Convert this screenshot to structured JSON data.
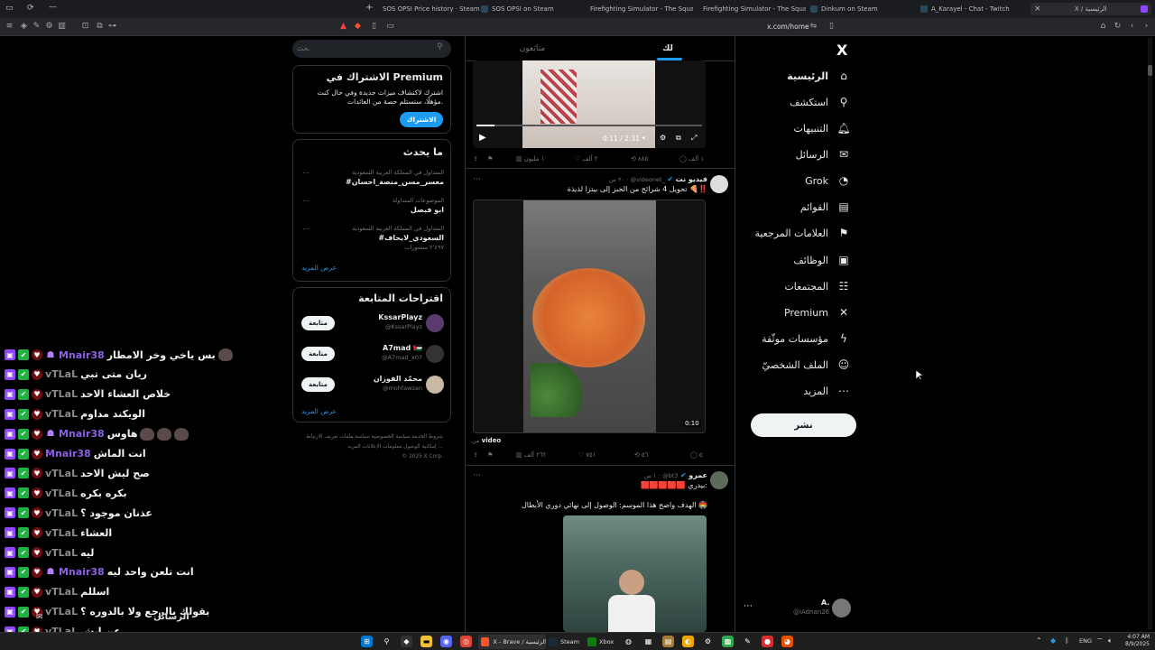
{
  "browser": {
    "tabs": [
      {
        "label": "SOS OPSI Price history · SteamDB",
        "color": "#8e0d0d"
      },
      {
        "label": "SOS OPSI on Steam",
        "color": "#171a21"
      },
      {
        "label": "Firefighting Simulator - The Squad",
        "color": "#c33"
      },
      {
        "label": "Firefighting Simulator - The Squad on",
        "color": "#171a21"
      },
      {
        "label": "Dinkum on Steam",
        "color": "#171a21"
      },
      {
        "label": "A_Karayel - Chat - Twitch",
        "color": "#171a21"
      },
      {
        "label": "X / الرئيسية",
        "color": "#9146ff"
      }
    ],
    "url": "x.com/home",
    "new_tab": "+",
    "close": "×"
  },
  "nav": {
    "logo": "X",
    "items": [
      {
        "label": "الرئيسية",
        "icon": "home-icon",
        "glyph": "⌂",
        "bold": true
      },
      {
        "label": "استكشف",
        "icon": "search-icon",
        "glyph": "⚲"
      },
      {
        "label": "التنبيهات",
        "icon": "bell-icon",
        "glyph": "🔔︎"
      },
      {
        "label": "الرسائل",
        "icon": "mail-icon",
        "glyph": "✉"
      },
      {
        "label": "Grok",
        "icon": "grok-icon",
        "glyph": "◔"
      },
      {
        "label": "القوائم",
        "icon": "list-icon",
        "glyph": "▤"
      },
      {
        "label": "العلامات المرجعية",
        "icon": "bookmark-icon",
        "glyph": "⚑"
      },
      {
        "label": "الوظائف",
        "icon": "briefcase-icon",
        "glyph": "▣"
      },
      {
        "label": "المجتمعات",
        "icon": "people-icon",
        "glyph": "☷"
      },
      {
        "label": "Premium",
        "icon": "x-premium-icon",
        "glyph": "✕"
      },
      {
        "label": "مؤسسات موثّقة",
        "icon": "lightning-icon",
        "glyph": "ϟ"
      },
      {
        "label": "الملف الشخصيّ",
        "icon": "person-icon",
        "glyph": "☺"
      },
      {
        "label": "المزيد",
        "icon": "more-circle-icon",
        "glyph": "⋯"
      }
    ],
    "post_button": "نشر",
    "account": {
      "name": "A.",
      "handle": "@iAdnan26",
      "more": "⋯"
    }
  },
  "feed": {
    "tabs": [
      "لك",
      "متابَعون"
    ],
    "video1": {
      "time": "0:11 / 2:31",
      "actions": {
        "reply": "١ ألف",
        "retweet": "٨٨٥",
        "like": "٢ ألف",
        "views": "١ مليون"
      }
    },
    "tweet2": {
      "name": "فيديو نت",
      "handle": "@videonet_",
      "time": "٢٠ س",
      "text": "تحويل 4 شرائح من الخبز إلى بيتزا لذيذة 🍕‼️",
      "duration": "0:10",
      "from_label": "من",
      "from_source": "video",
      "actions": {
        "reply": "٥",
        "retweet": "٥٦",
        "like": "٧٥١",
        "views": "٢٦٢ ألف"
      }
    },
    "tweet3": {
      "name": "عمرو",
      "handle": "@bt3",
      "time": "١ س",
      "line1": "🟥🟥🟥🟥🟥 بيدري:",
      "line2": "الهدف واضح هذا الموسم: الوصول إلى نهائي دوري الأبطال 🏟️"
    }
  },
  "sidebar": {
    "search_placeholder": "بحث",
    "premium": {
      "title": "الاشتراك في Premium",
      "text1": "اشترك لاكتشاف ميزات جديدة وفي حال كنت",
      "text2": "مؤهلًا، ستستلم حصة من العائدات.",
      "button": "الاشتراك"
    },
    "trends": {
      "title": "ما يحدث",
      "items": [
        {
          "context": "المتداول في المملكة العربية السعودية",
          "tag": "#معسر_مسن_منصة_احسان",
          "count": ""
        },
        {
          "context": "الموضوعات المتداولة",
          "tag": "ابو فيصل",
          "count": ""
        },
        {
          "context": "المتداول في المملكة العربية السعودية",
          "tag": "#السعودي_لايحاف",
          "count": "٢٬٤٩٧ منشورات"
        }
      ],
      "show_more": "عرض المزيد"
    },
    "who_to_follow": {
      "title": "اقتراحات المتابعة",
      "users": [
        {
          "name": "KssarPlayz",
          "handle": "@KssarPlayz",
          "button": "متابعة",
          "color": "#5a3b6e"
        },
        {
          "name": "A7mad 🇯🇴",
          "handle": "@A7mad_x07",
          "button": "متابعة",
          "color": "#333"
        },
        {
          "name": "محمّد الفوزان",
          "handle": "@mohfawzan",
          "button": "متابعة",
          "color": "#c9b8a4"
        }
      ],
      "show_more": "عرض المزيد"
    },
    "footer": {
      "row1": "شروط الخدمة  سياسة الخصوصية  سياسة ملفات تعريف الارتباط",
      "row2": "إمكانية الوصول  معلومات الإعلانات  المزيد ...",
      "row3": "© 2025 X Corp."
    }
  },
  "chat": {
    "messages": [
      {
        "user": "Mnair38",
        "text": "بس ياخي وخر الامطار",
        "emotes": 1,
        "sub": true,
        "purple": true
      },
      {
        "user": "vTLaL",
        "text": "ريان متى تبي",
        "emotes": 0,
        "sub": false,
        "purple": false
      },
      {
        "user": "vTLaL",
        "text": "خلاص العشاء الاحد",
        "emotes": 0,
        "sub": false,
        "purple": false
      },
      {
        "user": "vTLaL",
        "text": "الويكند مداوم",
        "emotes": 0,
        "sub": false,
        "purple": false
      },
      {
        "user": "Mnair38",
        "text": "هاوس",
        "emotes": 3,
        "sub": true,
        "purple": true
      },
      {
        "user": "Mnair38",
        "text": "انت الماش",
        "emotes": 0,
        "sub": false,
        "purple": true
      },
      {
        "user": "vTLaL",
        "text": "صح ليش الاحد",
        "emotes": 0,
        "sub": false,
        "purple": false
      },
      {
        "user": "vTLaL",
        "text": "بكره بكره",
        "emotes": 0,
        "sub": false,
        "purple": false
      },
      {
        "user": "vTLaL",
        "text": "عذنان موجود ؟",
        "emotes": 0,
        "sub": false,
        "purple": false
      },
      {
        "user": "vTLaL",
        "text": "العشاء",
        "emotes": 0,
        "sub": false,
        "purple": false
      },
      {
        "user": "vTLaL",
        "text": "ليه",
        "emotes": 0,
        "sub": false,
        "purple": false
      },
      {
        "user": "Mnair38",
        "text": "انت تلعن واحد ليه",
        "emotes": 0,
        "sub": true,
        "purple": true
      },
      {
        "user": "vTLaL",
        "text": "اسللم",
        "emotes": 0,
        "sub": false,
        "purple": false
      },
      {
        "user": "vTLaL",
        "text": "بقولك بالرجع ولا بالدوره ؟",
        "emotes": 0,
        "sub": false,
        "purple": false
      },
      {
        "user": "vTLaL",
        "text": "عن ايش",
        "emotes": 0,
        "sub": false,
        "purple": false
      }
    ],
    "overlay_label": "الرسائل"
  },
  "taskbar": {
    "brave_label": "X - Brave / الرئيسية",
    "steam_label": "Steam",
    "xbox_label": "Xbox",
    "lang": "ENG",
    "time": "4:07 AM",
    "date": "8/9/2025"
  }
}
